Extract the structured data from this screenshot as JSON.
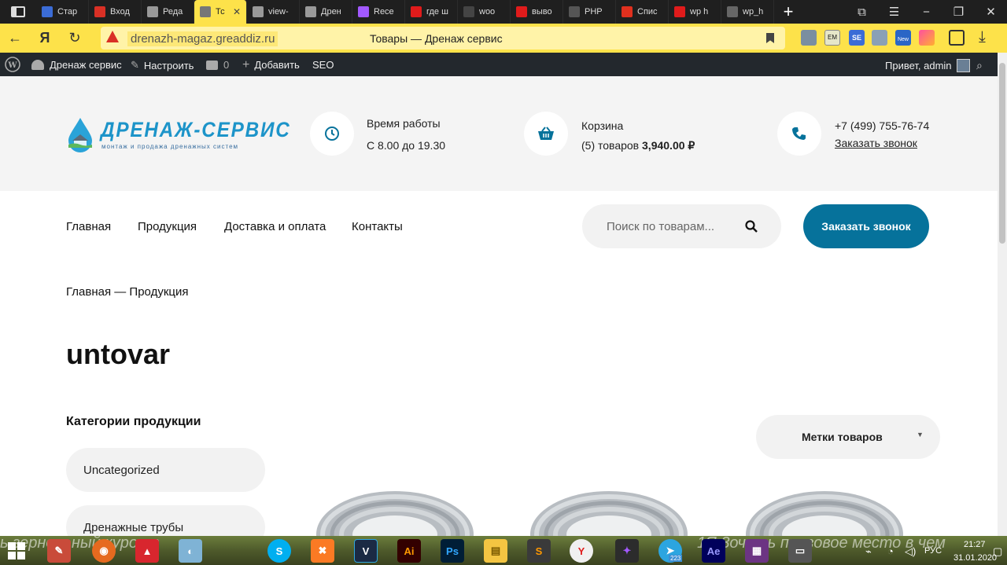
{
  "browser": {
    "tabs": [
      {
        "label": "Стар",
        "icon": "grid-icon",
        "color": "#3b6cd6"
      },
      {
        "label": "Вход",
        "icon": "mail-icon",
        "color": "#d93025"
      },
      {
        "label": "Реда",
        "icon": "doc-icon",
        "color": "#999999"
      },
      {
        "label": "Тс",
        "icon": "doc-icon",
        "color": "#777777"
      },
      {
        "label": "view-",
        "icon": "doc-icon",
        "color": "#999999"
      },
      {
        "label": "Дрен",
        "icon": "doc-icon",
        "color": "#999999"
      },
      {
        "label": "Rece",
        "icon": "figma-icon",
        "color": "#a259ff"
      },
      {
        "label": "где ш",
        "icon": "yandex-icon",
        "color": "#e01b1b"
      },
      {
        "label": "woo",
        "icon": "github-icon",
        "color": "#444444"
      },
      {
        "label": "выво",
        "icon": "yandex-icon",
        "color": "#e01b1b"
      },
      {
        "label": "PHP",
        "icon": "code-icon",
        "color": "#555555"
      },
      {
        "label": "Спис",
        "icon": "lifebuoy-icon",
        "color": "#e0301e"
      },
      {
        "label": "wp h",
        "icon": "yandex-icon",
        "color": "#e01b1b"
      },
      {
        "label": "wp_h",
        "icon": "pen-icon",
        "color": "#666666"
      }
    ],
    "url": "drenazh-magaz.greaddiz.ru",
    "page_title": "Товары — Дренаж сервис"
  },
  "wpbar": {
    "site_name": "Дренаж сервис",
    "customize": "Настроить",
    "comments": "0",
    "add_new": "Добавить",
    "seo": "SEO",
    "greeting": "Привет, admin"
  },
  "header": {
    "logo_title": "ДРЕНАЖ-СЕРВИС",
    "logo_subtitle": "монтаж и продажа дренажных систем",
    "hours_label": "Время работы",
    "hours_value": "С 8.00 до 19.30",
    "cart_label": "Корзина",
    "cart_count": "(5) товаров",
    "cart_total": "3,940.00 ₽",
    "phone": "+7 (499) 755-76-74",
    "callback_link": "Заказать звонок"
  },
  "nav": {
    "items": [
      "Главная",
      "Продукция",
      "Доставка и оплата",
      "Контакты"
    ],
    "search_placeholder": "Поиск по товарам...",
    "call_button": "Заказать звонок"
  },
  "breadcrumb": "Главная — Продукция",
  "page_heading": "untovar",
  "sidebar": {
    "title": "Категории продукции",
    "categories": [
      "Uncategorized",
      "Дренажные трубы"
    ]
  },
  "tags_select": {
    "label": "Метки товаров"
  },
  "taskbar": {
    "wallpaper_text_left": "ь зернольный курорт",
    "wallpaper_text_right": "1Я 3очать призовое место в чем",
    "telegram_badge": "223",
    "lang": "РУС",
    "time": "21:27",
    "date": "31.01.2020"
  },
  "colors": {
    "accent": "#06729b",
    "browser_yellow": "#fde24a",
    "wp_bar": "#23282d"
  }
}
